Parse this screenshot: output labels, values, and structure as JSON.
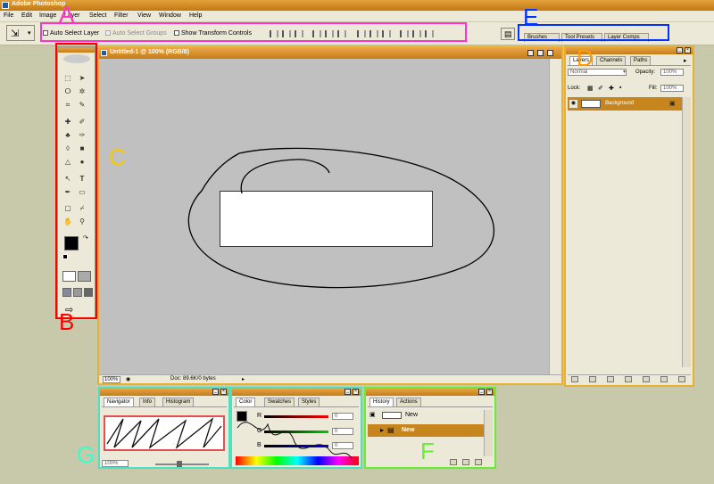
{
  "app": {
    "title": "Adobe Photoshop"
  },
  "menu": [
    "File",
    "Edit",
    "Image",
    "Layer",
    "Select",
    "Filter",
    "View",
    "Window",
    "Help"
  ],
  "options": {
    "auto_select_layer": "Auto Select Layer",
    "auto_select_groups": "Auto Select Groups",
    "show_transform": "Show Transform Controls"
  },
  "palette_well": {
    "tabs": [
      "Brushes",
      "Tool Presets",
      "Layer Comps"
    ]
  },
  "document": {
    "title": "Untitled-1 @ 100% (RGB/8)",
    "zoom": "100%",
    "doc_info": "Doc: 89.6K/0 bytes"
  },
  "layers_panel": {
    "tabs": [
      "Layers",
      "Channels",
      "Paths"
    ],
    "blend_mode": "Normal",
    "opacity_label": "Opacity:",
    "opacity_value": "100%",
    "lock_label": "Lock:",
    "fill_label": "Fill:",
    "fill_value": "100%",
    "layer_name": "Background"
  },
  "navigator_panel": {
    "tabs": [
      "Navigator",
      "Info",
      "Histogram"
    ],
    "zoom": "100%"
  },
  "color_panel": {
    "tabs": [
      "Color",
      "Swatches",
      "Styles"
    ],
    "r_label": "R",
    "g_label": "G",
    "b_label": "B",
    "r_value": "0",
    "g_value": "0",
    "b_value": "0"
  },
  "history_panel": {
    "tabs": [
      "History",
      "Actions"
    ],
    "snapshot_label": "New",
    "state_label": "New"
  },
  "annotations": {
    "a": "A",
    "b": "B",
    "c": "C",
    "d": "D",
    "e": "E",
    "f": "F",
    "g": "G"
  },
  "colors": {
    "accent": "#c47d18",
    "mark_a": "#ff33cc",
    "mark_b": "#ff0000",
    "mark_c": "#f5c800",
    "mark_d": "#ff9900",
    "mark_e": "#0033ff",
    "mark_f": "#66ee33",
    "mark_g": "#33ffcc"
  }
}
